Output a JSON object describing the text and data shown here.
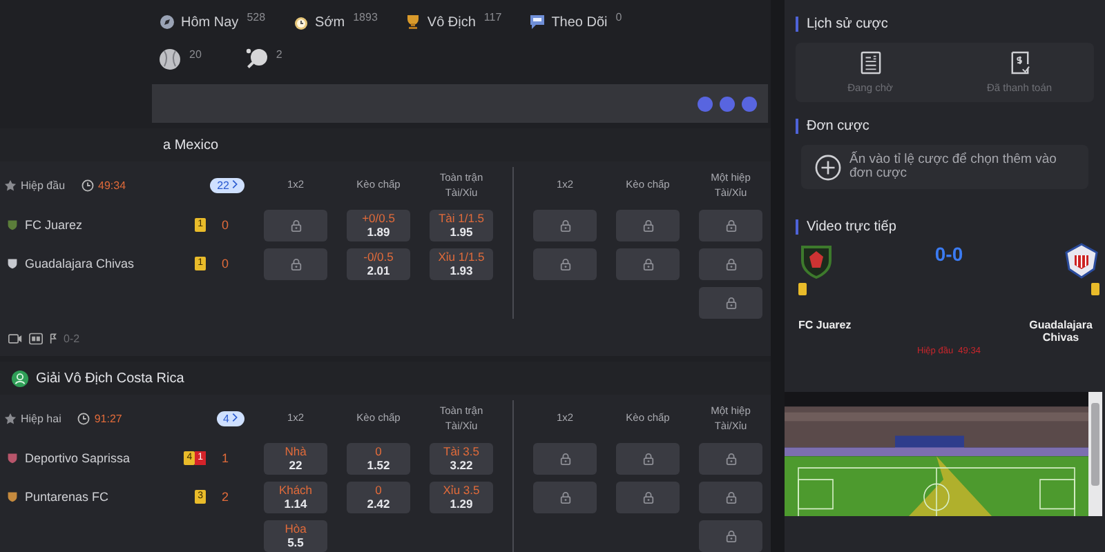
{
  "nav": [
    {
      "label": "Hôm Nay",
      "count": "528"
    },
    {
      "label": "Sớm",
      "count": "1893"
    },
    {
      "label": "Vô Địch",
      "count": "117"
    },
    {
      "label": "Theo Dõi",
      "count": "0"
    }
  ],
  "sports": [
    {
      "count": "20"
    },
    {
      "count": "2"
    }
  ],
  "leagues": [
    {
      "name": "a Mexico",
      "crest": false,
      "period": "Hiệp đầu",
      "clock": "49:34",
      "more": "22",
      "columns": [
        "1x2",
        "Kèo chấp",
        "Toàn trận Tài/Xỉu",
        "1x2",
        "Kèo chấp",
        "Một hiệp Tài/Xỉu"
      ],
      "rows": [
        {
          "team": {
            "name": "FC Juarez",
            "yellow": "1",
            "score": "0"
          },
          "cells": [
            {
              "kind": "locked"
            },
            {
              "kind": "odds",
              "label": "+0/0.5",
              "price": "1.89"
            },
            {
              "kind": "odds",
              "label": "Tài 1/1.5",
              "price": "1.95"
            },
            {
              "kind": "locked"
            },
            {
              "kind": "locked"
            },
            {
              "kind": "locked"
            }
          ]
        },
        {
          "team": {
            "name": "Guadalajara Chivas",
            "yellow": "1",
            "score": "0"
          },
          "cells": [
            {
              "kind": "locked"
            },
            {
              "kind": "odds",
              "label": "-0/0.5",
              "price": "2.01"
            },
            {
              "kind": "odds",
              "label": "Xỉu 1/1.5",
              "price": "1.93"
            },
            {
              "kind": "locked"
            },
            {
              "kind": "locked"
            },
            {
              "kind": "locked"
            }
          ]
        },
        {
          "cells": [
            {
              "kind": "none"
            },
            {
              "kind": "none"
            },
            {
              "kind": "none"
            },
            {
              "kind": "none"
            },
            {
              "kind": "none"
            },
            {
              "kind": "locked"
            }
          ]
        }
      ],
      "footer": {
        "score": "0-2"
      }
    },
    {
      "name": "Giải Vô Địch Costa Rica",
      "crest": true,
      "period": "Hiệp hai",
      "clock": "91:27",
      "more": "4",
      "columns": [
        "1x2",
        "Kèo chấp",
        "Toàn trận Tài/Xỉu",
        "1x2",
        "Kèo chấp",
        "Một hiệp Tài/Xỉu"
      ],
      "rows": [
        {
          "team": {
            "name": "Deportivo Saprissa",
            "yellow": "4",
            "red": "1",
            "score": "1"
          },
          "cells": [
            {
              "kind": "odds",
              "label": "Nhà",
              "price": "22"
            },
            {
              "kind": "odds",
              "label": "0",
              "price": "1.52"
            },
            {
              "kind": "odds",
              "label": "Tài 3.5",
              "price": "3.22"
            },
            {
              "kind": "locked"
            },
            {
              "kind": "locked"
            },
            {
              "kind": "locked"
            }
          ]
        },
        {
          "team": {
            "name": "Puntarenas FC",
            "yellow": "3",
            "score": "2"
          },
          "cells": [
            {
              "kind": "odds",
              "label": "Khách",
              "price": "1.14"
            },
            {
              "kind": "odds",
              "label": "0",
              "price": "2.42"
            },
            {
              "kind": "odds",
              "label": "Xỉu 3.5",
              "price": "1.29"
            },
            {
              "kind": "locked"
            },
            {
              "kind": "locked"
            },
            {
              "kind": "locked"
            }
          ]
        },
        {
          "cells": [
            {
              "kind": "odds",
              "label": "Hòa",
              "price": "5.5"
            },
            {
              "kind": "none"
            },
            {
              "kind": "none"
            },
            {
              "kind": "none"
            },
            {
              "kind": "none"
            },
            {
              "kind": "locked"
            }
          ]
        }
      ]
    }
  ],
  "side": {
    "history": {
      "title": "Lịch sử cược",
      "items": [
        "Đang chờ",
        "Đã thanh toán"
      ]
    },
    "slip": {
      "title": "Đơn cược",
      "hint": "Ấn vào tỉ lệ cược để chọn thêm vào đơn cược"
    },
    "video": {
      "title": "Video trực tiếp",
      "home": "FC Juarez",
      "away": "Guadalajara Chivas",
      "score": "0-0",
      "period": "Hiệp đầu",
      "clock": "49:34"
    }
  }
}
